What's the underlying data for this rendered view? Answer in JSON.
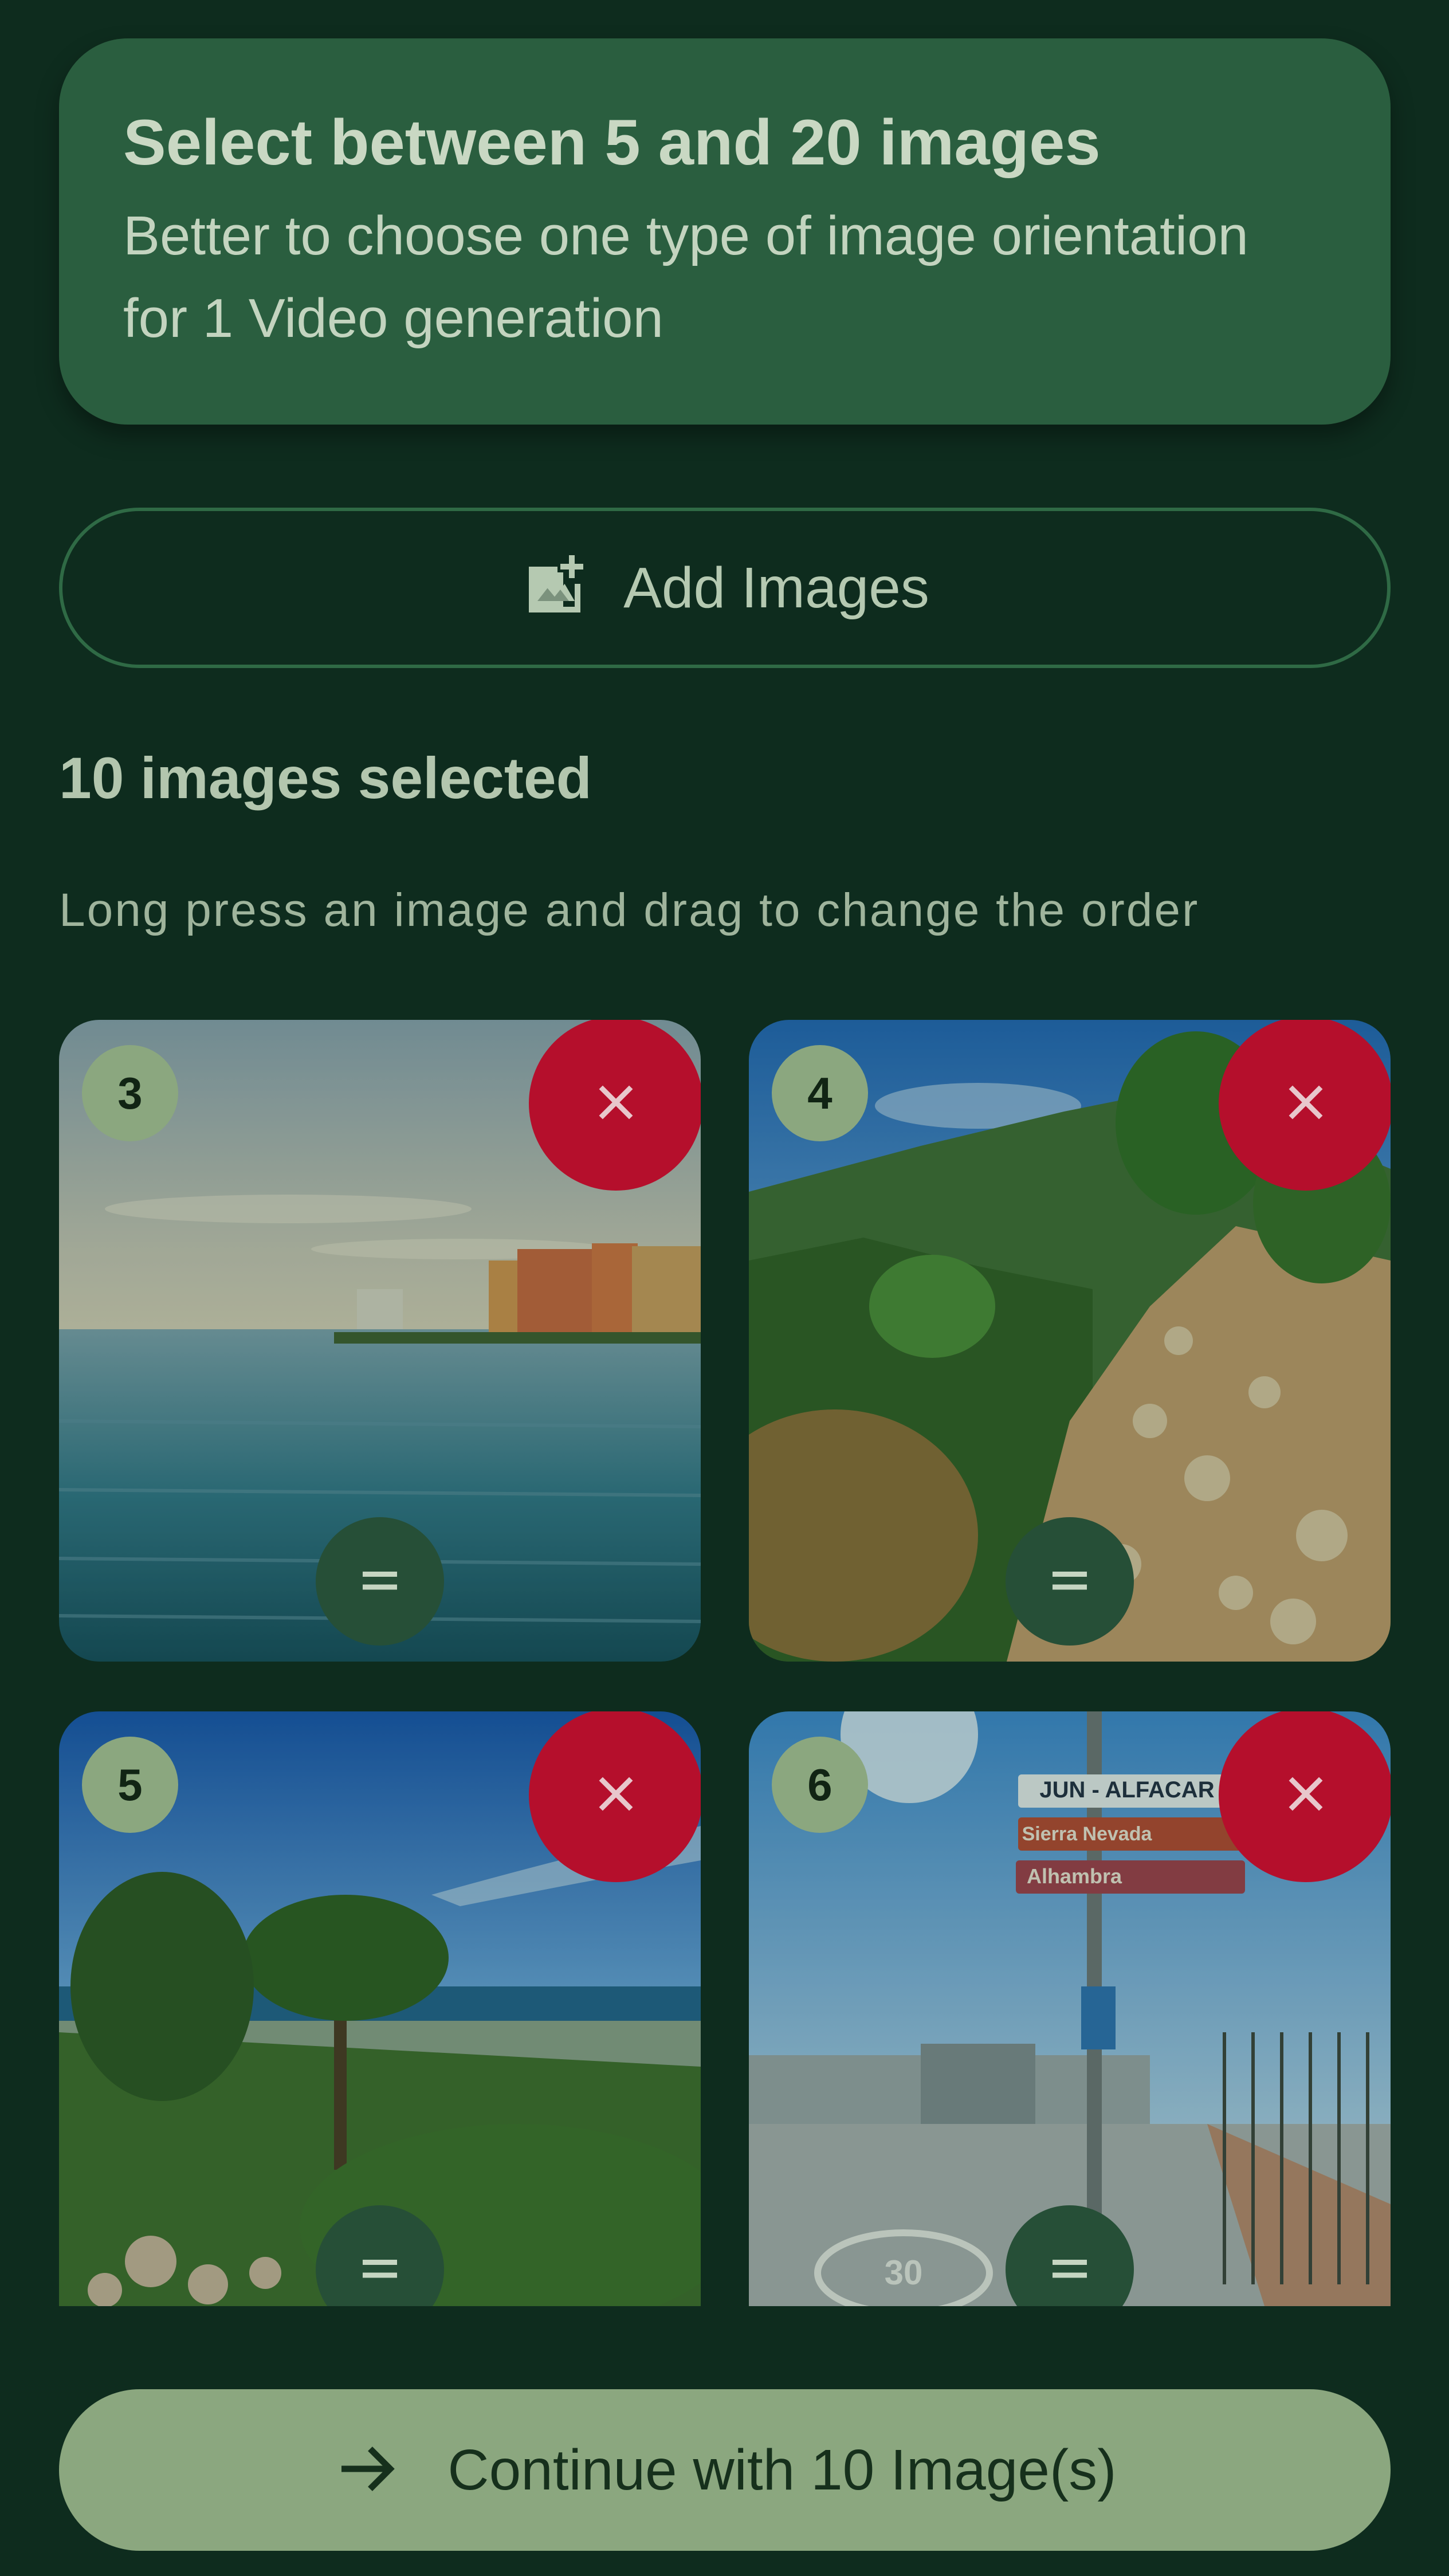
{
  "instructions": {
    "title": "Select between 5 and 20 images",
    "body": "Better to choose one type of image orientation for 1 Video generation"
  },
  "add_images": {
    "label": "Add Images",
    "icon": "add-photo-icon"
  },
  "selection": {
    "count_text": "10 images selected",
    "hint_text": "Long press an image and drag to change the order"
  },
  "images": [
    {
      "order": "3",
      "subject": "seaside hotels and calm sea",
      "remove_icon": "close-icon",
      "drag_icon": "drag-handle-icon"
    },
    {
      "order": "4",
      "subject": "rocky mountain trail",
      "remove_icon": "close-icon",
      "drag_icon": "drag-handle-icon"
    },
    {
      "order": "5",
      "subject": "pine trees above coastal town",
      "remove_icon": "close-icon",
      "drag_icon": "drag-handle-icon"
    },
    {
      "order": "6",
      "subject": "street with direction signs",
      "remove_icon": "close-icon",
      "drag_icon": "drag-handle-icon"
    }
  ],
  "sign_texts": [
    "JUN - ALFACAR",
    "Sierra Nevada",
    "Alhambra",
    "30"
  ],
  "continue_button": {
    "label": "Continue with 10 Image(s)",
    "icon": "arrow-right-icon"
  },
  "colors": {
    "background": "#0e2c1e",
    "card": "#2a5e3f",
    "primary_button": "#8ba77f",
    "remove": "#b50f2c"
  }
}
